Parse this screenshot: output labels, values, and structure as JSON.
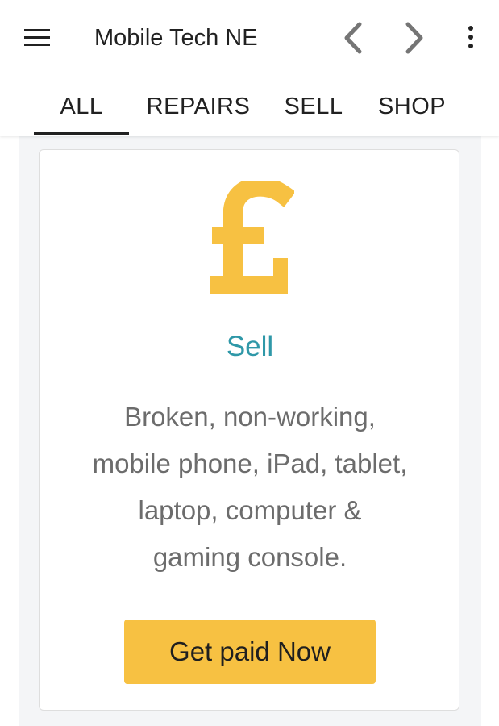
{
  "app_bar": {
    "title": "Mobile Tech NE",
    "icons": {
      "menu": "menu-icon",
      "back": "chevron-left-icon",
      "forward": "chevron-right-icon",
      "more": "more-vertical-icon"
    }
  },
  "tabs": [
    {
      "label": "ALL",
      "selected": true
    },
    {
      "label": "REPAIRS",
      "selected": false
    },
    {
      "label": "SELL",
      "selected": false
    },
    {
      "label": "SHOP",
      "selected": false
    }
  ],
  "card": {
    "icon": "pound-sign-icon",
    "title": "Sell",
    "description_lines": [
      "Broken, non-working,",
      "mobile phone, iPad, tablet,",
      "laptop, computer &",
      "gaming console."
    ],
    "button_label": "Get paid Now"
  },
  "colors": {
    "accent_yellow": "#f7c142",
    "title_teal": "#2f98a8",
    "body_text": "#6c6c6c",
    "page_background": "#f4f5f7"
  }
}
